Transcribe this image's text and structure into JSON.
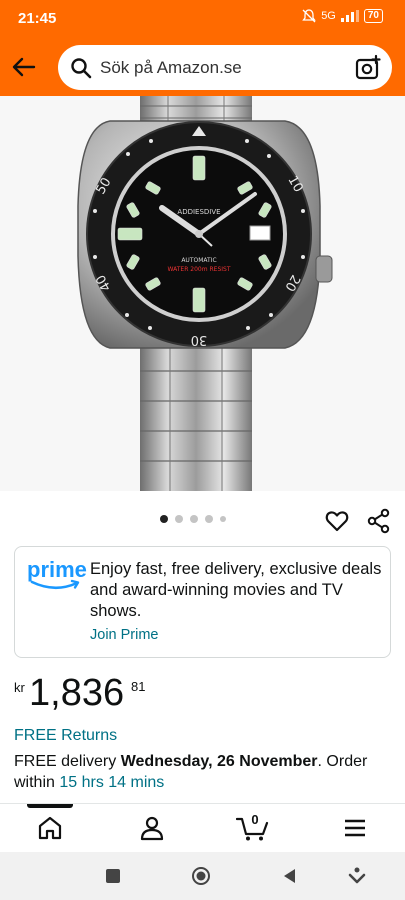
{
  "status_bar": {
    "time": "21:45",
    "network": "5G",
    "battery": "70"
  },
  "search": {
    "placeholder": "Sök på Amazon.se"
  },
  "prime": {
    "logo_text": "prime",
    "message": "Enjoy fast, free delivery, exclusive deals and award-winning movies and TV shows.",
    "cta": "Join Prime"
  },
  "price": {
    "symbol": "kr",
    "whole": "1,836",
    "fraction": "81"
  },
  "returns": {
    "label": "FREE Returns"
  },
  "delivery": {
    "prefix": "FREE delivery",
    "date": "Wednesday, 26 November",
    "order_within": ". Order within",
    "countdown": "15 hrs 14 mins"
  },
  "watch_dial": {
    "brand": "ADDIESDIVE",
    "movement": "AUTOMATIC",
    "water_resist": "WATER 200m RESIST",
    "bezel_numbers": [
      "10",
      "20",
      "30",
      "40",
      "50"
    ]
  },
  "bottom_nav": {
    "cart_count": "0"
  },
  "colors": {
    "header": "#ff6a00",
    "link": "#007185",
    "prime_blue": "#1a98ff"
  }
}
